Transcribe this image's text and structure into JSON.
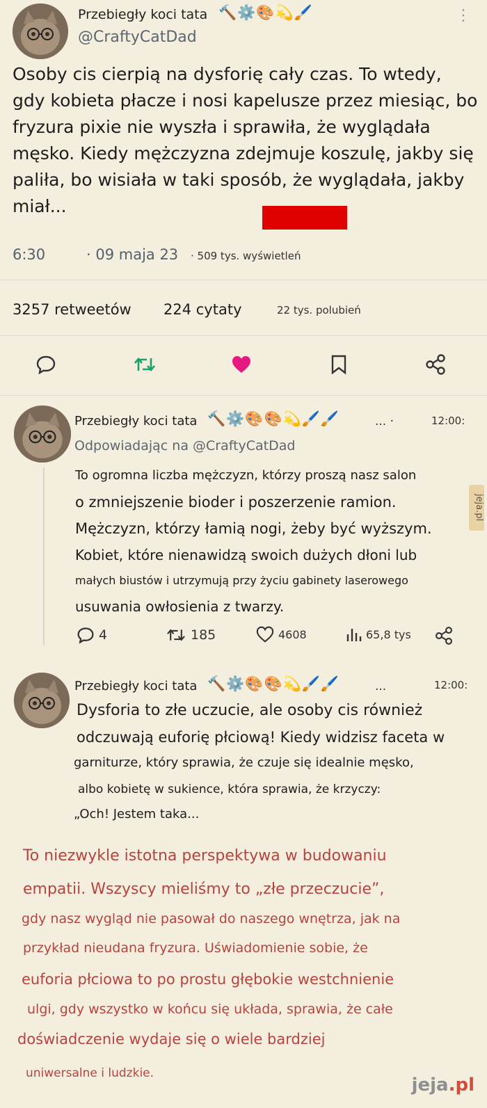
{
  "tweet": {
    "author_name": "Przebiegły koci tata",
    "author_emojis": "🔨⚙️🎨💫🖌️",
    "handle": "@CraftyCatDad",
    "text_lines": [
      "Osoby cis cierpią na dysforię cały czas. To wtedy,",
      "gdy kobieta płacze i nosi kapelusze przez miesiąc, bo",
      "fryzura pixie nie wyszła i sprawiła, że wyglądała",
      "męsko. Kiedy mężczyzna zdejmuje koszulę, jakby się",
      "paliła, bo wisiała w taki sposób, że wyglądała, jakby",
      "miał..."
    ],
    "time": "6:30",
    "date": "· 09 maja 23",
    "views": "· 509 tys. wyświetleń",
    "retweets": "3257 retweetów",
    "quotes": "224 cytaty",
    "likes": "22 tys. polubień"
  },
  "reply1": {
    "author_name": "Przebiegły koci tata",
    "author_emojis": "🔨⚙️🎨🎨💫🖌️🖌️",
    "ellipsis": "... ·",
    "time": "12:00:",
    "replying_to": "Odpowiadając na @CraftyCatDad",
    "text_lines": [
      "To ogromna liczba mężczyzn, którzy proszą nasz salon",
      "o zmniejszenie bioder i poszerzenie ramion.",
      "Mężczyzn, którzy łamią nogi, żeby być wyższym.",
      "Kobiet, które nienawidzą swoich dużych dłoni lub",
      "małych biustów i utrzymują przy życiu gabinety laserowego",
      "usuwania owłosienia z twarzy."
    ],
    "replies": "4",
    "retweets": "185",
    "likes": "4608",
    "views": "65,8 tys"
  },
  "reply2": {
    "author_name": "Przebiegły koci tata",
    "author_emojis": "🔨⚙️🎨🎨💫🖌️🖌️",
    "ellipsis": "...",
    "time": "12:00:",
    "text_lines": [
      "Dysforia to złe uczucie, ale osoby cis również",
      "odczuwają euforię płciową! Kiedy widzisz faceta w",
      "garniturze, który sprawia, że czuje się idealnie męsko,",
      "albo kobietę w sukience, która sprawia, że krzyczy:",
      "„Och! Jestem taka..."
    ]
  },
  "commentary": {
    "lines": [
      "To niezwykle istotna perspektywa w budowaniu",
      "empatii. Wszyscy mieliśmy to „złe przeczucie”,",
      "gdy nasz wygląd nie pasował do naszego wnętrza, jak na",
      "przykład nieudana fryzura. Uświadomienie sobie, że",
      "euforia płciowa to po prostu głębokie westchnienie",
      "ulgi, gdy wszystko w końcu się układa, sprawia, że całe",
      "doświadczenie wydaje się o wiele bardziej",
      "uniwersalne i ludzkie."
    ]
  },
  "watermark": {
    "side": "jeja.pl",
    "bottom_main": "jeja",
    "bottom_suffix": ".pl"
  },
  "colors": {
    "background": "#f4eede",
    "retweet_green": "#17a36a",
    "like_pink": "#e5197f",
    "commentary_red": "#b5443f",
    "redaction": "#e00000"
  }
}
